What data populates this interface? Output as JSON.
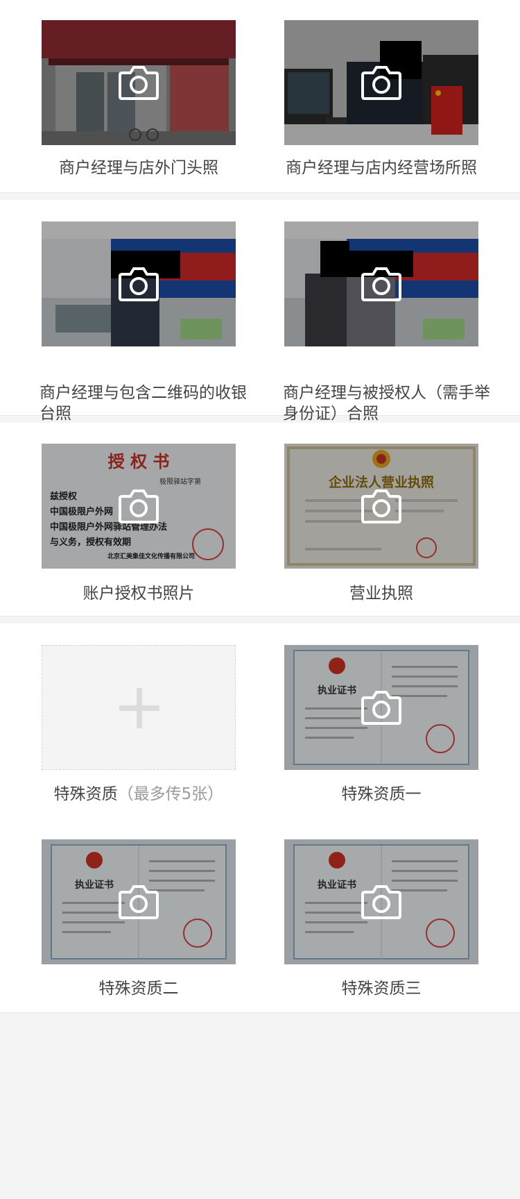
{
  "uploads": [
    {
      "label": "商户经理与店外门头照",
      "icon": "camera-icon"
    },
    {
      "label": "商户经理与店内经营场所照",
      "icon": "camera-icon"
    },
    {
      "label": "商户经理与包含二维码的收银台照",
      "icon": "camera-icon"
    },
    {
      "label": "商户经理与被授权人（需手举身份证）合照",
      "icon": "camera-icon"
    },
    {
      "label": "账户授权书照片",
      "icon": "camera-icon"
    },
    {
      "label": "营业执照",
      "icon": "camera-icon"
    },
    {
      "label": "特殊资质",
      "hint": "（最多传5张）",
      "icon": "plus-icon"
    },
    {
      "label": "特殊资质一",
      "icon": "camera-icon"
    },
    {
      "label": "特殊资质二",
      "icon": "camera-icon"
    },
    {
      "label": "特殊资质三",
      "icon": "camera-icon"
    }
  ],
  "photo_text": {
    "auth_letter_title": "授 权 书",
    "auth_letter_number": "极限驿站字第",
    "auth_letter_lines": [
      "兹授权",
      "中国极限户外网",
      "中国极限户外网驿站管理办法",
      "与义务，授权有效期"
    ],
    "auth_letter_sign": "北京汇美集佳文化传播有限公司",
    "license_title": "企业法人营业执照",
    "cert_title": "执业证书"
  },
  "colors": {
    "background": "#f4f4f4",
    "card": "#ffffff",
    "label": "#444444",
    "hint": "#9a9a9a"
  }
}
